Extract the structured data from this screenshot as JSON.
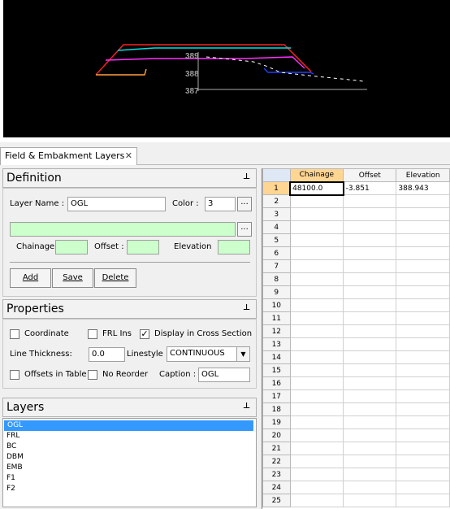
{
  "canvas": {
    "elevation_labels": [
      "389",
      "388",
      "387"
    ],
    "background": "#000000"
  },
  "tabs": [
    {
      "label": "Field & Embakment Layers",
      "active": true,
      "close": "✕"
    }
  ],
  "definition": {
    "title": "Definition",
    "pin": "⊥",
    "layer_name_label": "Layer Name :",
    "layer_name_value": "OGL",
    "color_label": "Color :",
    "color_value": "3",
    "browse": "...",
    "chainage_label": "Chainage :",
    "offset_label": "Offset :",
    "elevation_label": "Elevation",
    "chainage_value": "",
    "offset_value": "",
    "elevation_value": "",
    "add_label": "Add",
    "save_label": "Save",
    "delete_label": "Delete"
  },
  "properties": {
    "title": "Properties",
    "pin": "⊥",
    "coordinate_label": "Coordinate",
    "coordinate_checked": false,
    "frl_ins_label": "FRL Ins",
    "frl_ins_checked": false,
    "display_cross_section_label": "Display in Cross Section",
    "display_cross_section_checked": true,
    "line_thickness_label": "Line Thickness:",
    "line_thickness_value": "0.0",
    "linestyle_label": "Linestyle",
    "linestyle_value": "CONTINUOUS",
    "offsets_in_table_label": "Offsets in Table",
    "offsets_in_table_checked": false,
    "no_reorder_label": "No Reorder",
    "no_reorder_checked": false,
    "caption_label": "Caption :",
    "caption_value": "OGL",
    "check_mark": "✓"
  },
  "layers": {
    "title": "Layers",
    "pin": "⊥",
    "items": [
      "OGL",
      "FRL",
      "BC",
      "DBM",
      "EMB",
      "F1",
      "F2"
    ],
    "selected_index": 0
  },
  "grid": {
    "columns": [
      "Chainage",
      "Offset",
      "Elevation"
    ],
    "active_column": 0,
    "rows": [
      {
        "n": "1",
        "chainage": "48100.0",
        "offset": "-3.851",
        "elevation": "388.943"
      },
      {
        "n": "2",
        "chainage": "",
        "offset": "",
        "elevation": ""
      },
      {
        "n": "3",
        "chainage": "",
        "offset": "",
        "elevation": ""
      },
      {
        "n": "4",
        "chainage": "",
        "offset": "",
        "elevation": ""
      },
      {
        "n": "5",
        "chainage": "",
        "offset": "",
        "elevation": ""
      },
      {
        "n": "6",
        "chainage": "",
        "offset": "",
        "elevation": ""
      },
      {
        "n": "7",
        "chainage": "",
        "offset": "",
        "elevation": ""
      },
      {
        "n": "8",
        "chainage": "",
        "offset": "",
        "elevation": ""
      },
      {
        "n": "9",
        "chainage": "",
        "offset": "",
        "elevation": ""
      },
      {
        "n": "10",
        "chainage": "",
        "offset": "",
        "elevation": ""
      },
      {
        "n": "11",
        "chainage": "",
        "offset": "",
        "elevation": ""
      },
      {
        "n": "12",
        "chainage": "",
        "offset": "",
        "elevation": ""
      },
      {
        "n": "13",
        "chainage": "",
        "offset": "",
        "elevation": ""
      },
      {
        "n": "14",
        "chainage": "",
        "offset": "",
        "elevation": ""
      },
      {
        "n": "15",
        "chainage": "",
        "offset": "",
        "elevation": ""
      },
      {
        "n": "16",
        "chainage": "",
        "offset": "",
        "elevation": ""
      },
      {
        "n": "17",
        "chainage": "",
        "offset": "",
        "elevation": ""
      },
      {
        "n": "18",
        "chainage": "",
        "offset": "",
        "elevation": ""
      },
      {
        "n": "19",
        "chainage": "",
        "offset": "",
        "elevation": ""
      },
      {
        "n": "20",
        "chainage": "",
        "offset": "",
        "elevation": ""
      },
      {
        "n": "21",
        "chainage": "",
        "offset": "",
        "elevation": ""
      },
      {
        "n": "22",
        "chainage": "",
        "offset": "",
        "elevation": ""
      },
      {
        "n": "23",
        "chainage": "",
        "offset": "",
        "elevation": ""
      },
      {
        "n": "24",
        "chainage": "",
        "offset": "",
        "elevation": ""
      },
      {
        "n": "25",
        "chainage": "",
        "offset": "",
        "elevation": ""
      }
    ]
  }
}
